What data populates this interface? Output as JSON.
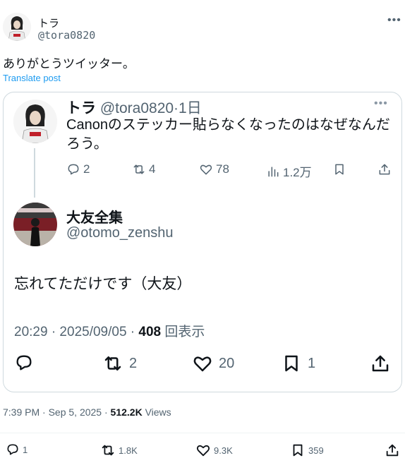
{
  "outer_tweet": {
    "display_name": "トラ",
    "handle": "@tora0820",
    "text": "ありがとうツイッター。",
    "translate_label": "Translate post",
    "timestamp": "7:39 PM · Sep 5, 2025 · ",
    "views_count": "512.2K",
    "views_label": " Views",
    "actions": {
      "reply": "1",
      "retweet": "1.8K",
      "like": "9.3K",
      "bookmark": "359"
    }
  },
  "quoted_thread": {
    "first": {
      "display_name": "トラ",
      "handle_time": " @tora0820·1日",
      "text": "Canonのステッカー貼らなくなったのはなぜなんだろう。",
      "actions": {
        "reply": "2",
        "retweet": "4",
        "like": "78",
        "views": "1.2万"
      }
    },
    "reply": {
      "display_name": "大友全集",
      "handle": "@otomo_zenshu",
      "text": "忘れてただけです（大友）",
      "timestamp": "20:29 · 2025/09/05 · ",
      "views_count": "408",
      "views_label": " 回表示",
      "actions": {
        "retweet": "2",
        "like": "20",
        "bookmark": "1"
      }
    }
  },
  "icons": {
    "more": "more-dots-icon",
    "reply": "reply-icon",
    "retweet": "retweet-icon",
    "like": "heart-icon",
    "views": "views-chart-icon",
    "bookmark": "bookmark-icon",
    "share": "share-icon"
  },
  "colors": {
    "link": "#1d9bf0",
    "secondary_text": "#536471",
    "border": "#cfd9de"
  }
}
